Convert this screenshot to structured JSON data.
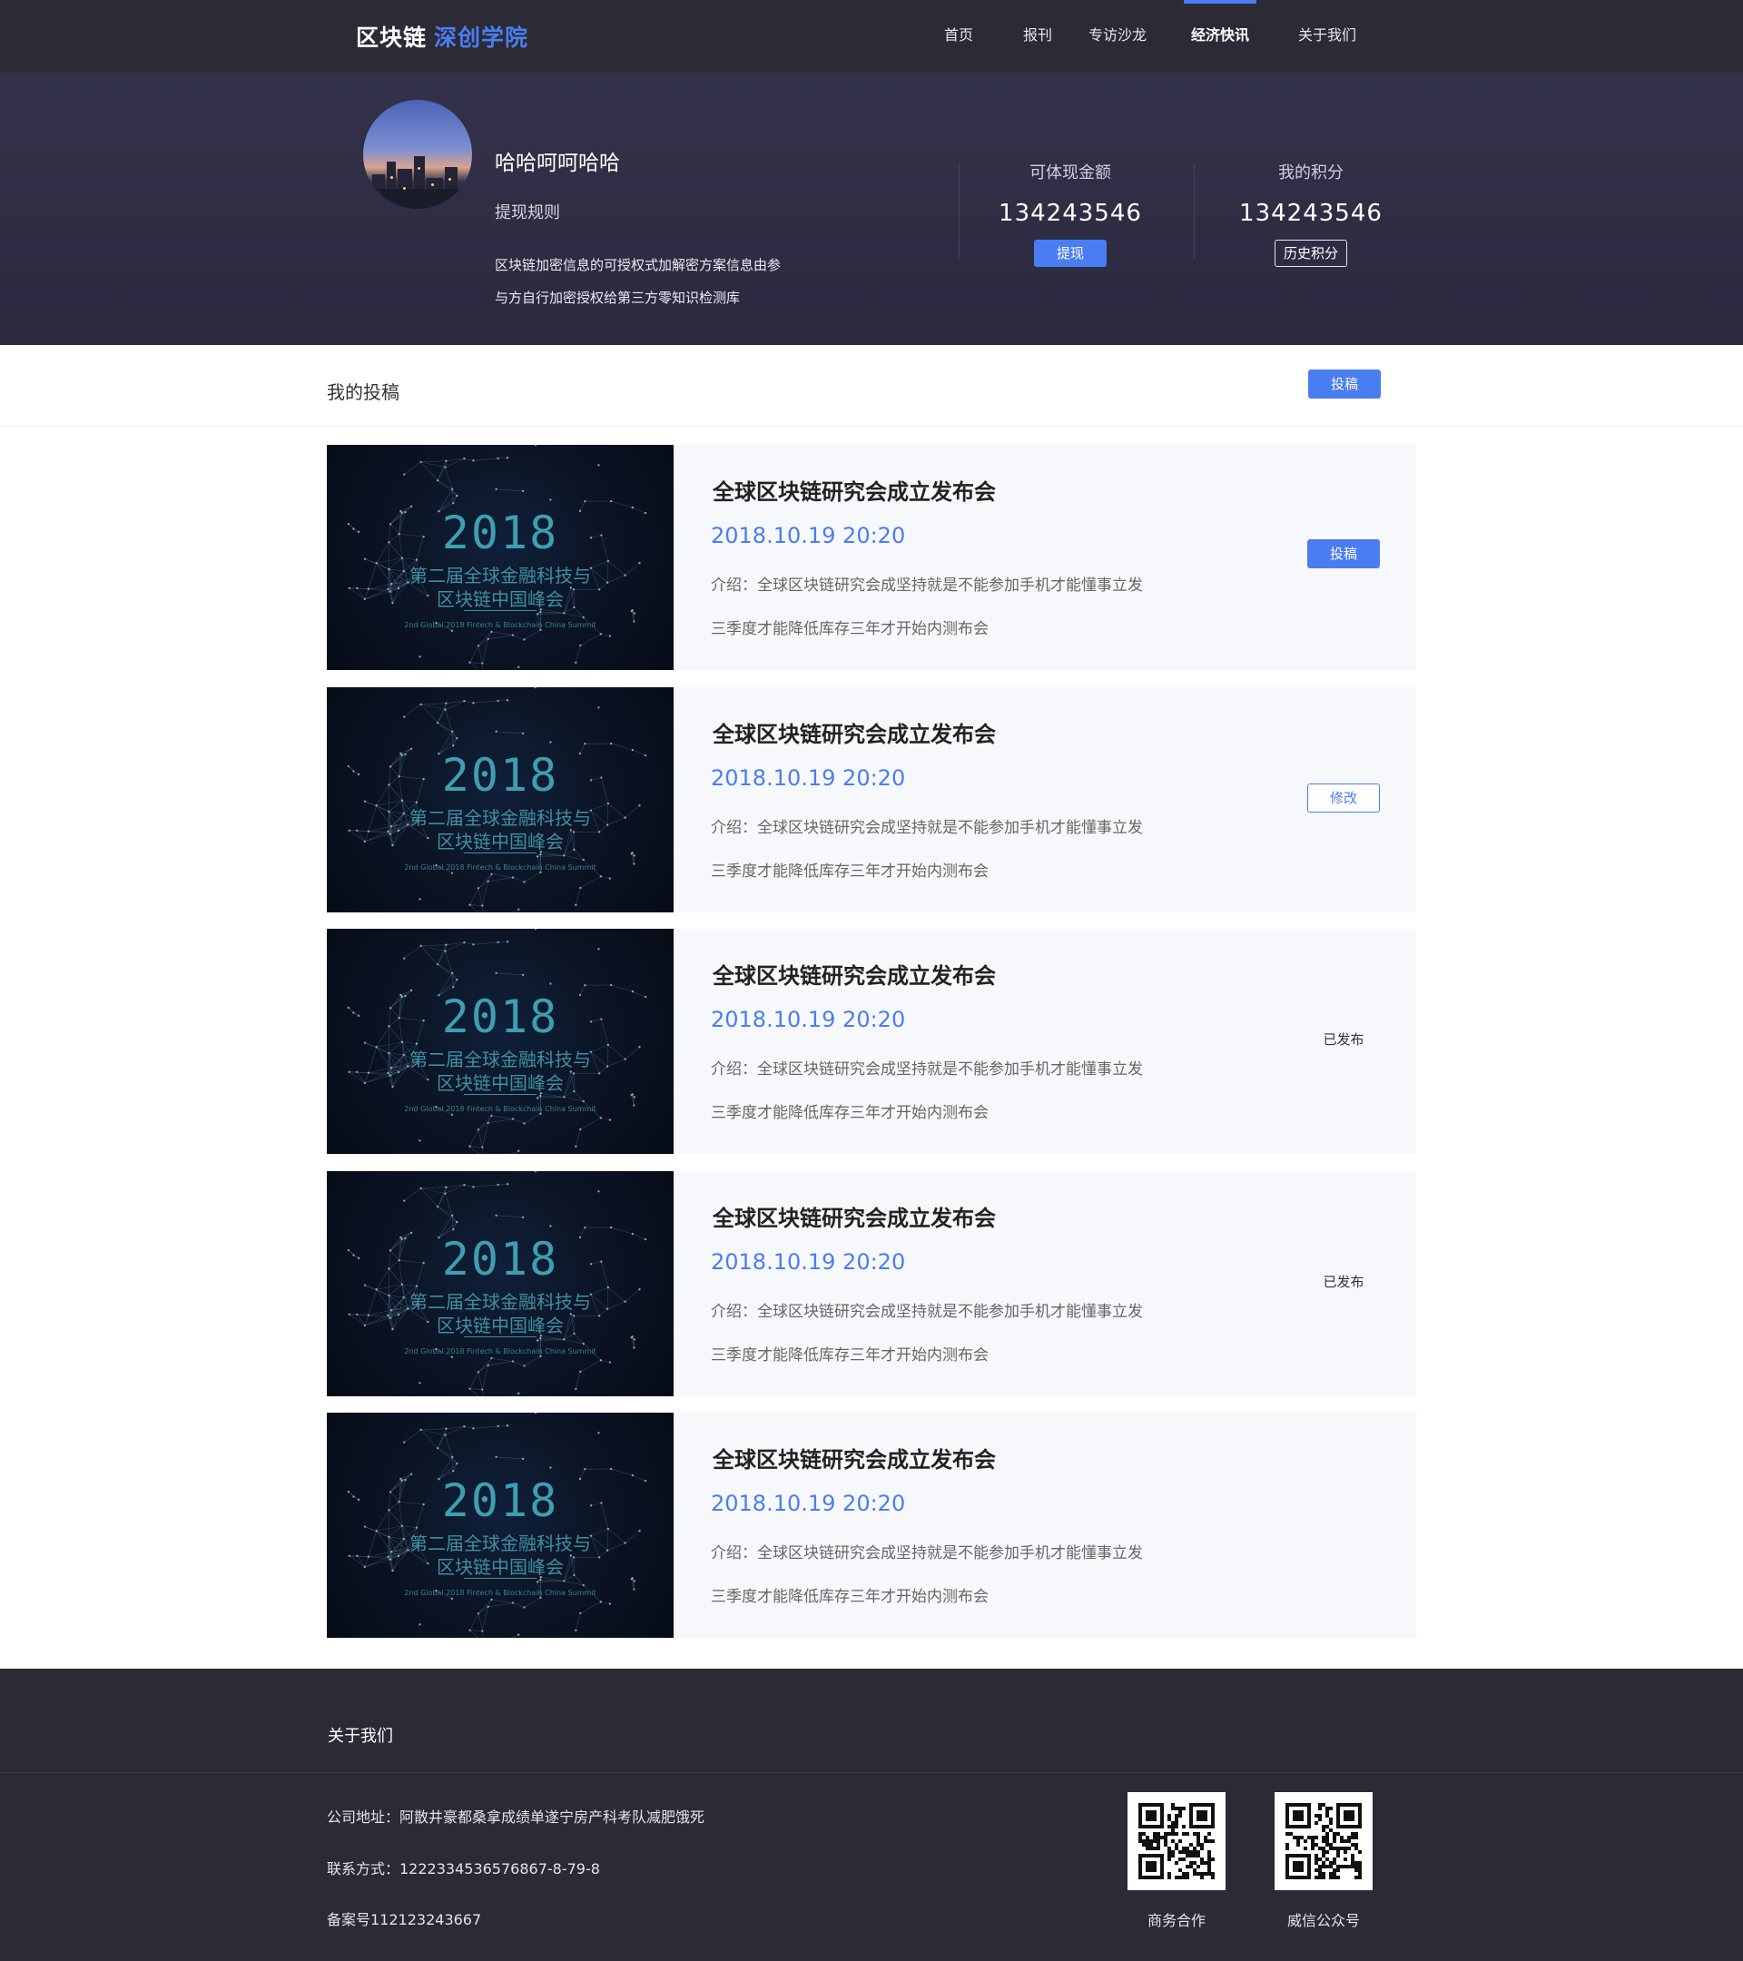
{
  "header": {
    "logo_main": "区块链",
    "logo_accent": "深创学院",
    "nav": [
      {
        "label": "首页",
        "active": false
      },
      {
        "label": "报刊",
        "active": false
      },
      {
        "label": "专访沙龙",
        "active": false
      },
      {
        "label": "经济快讯",
        "active": true
      },
      {
        "label": "关于我们",
        "active": false
      }
    ]
  },
  "profile": {
    "name": "哈哈呵呵哈哈",
    "rules_link": "提现规则",
    "rules_line1": "区块链加密信息的可授权式加解密方案信息由参",
    "rules_line2": "与方自行加密授权给第三方零知识检测库",
    "withdrawable": {
      "label": "可体现金额",
      "value": "134243546",
      "button": "提现"
    },
    "points": {
      "label": "我的积分",
      "value": "134243546",
      "button": "历史积分"
    }
  },
  "submissions": {
    "title": "我的投稿",
    "submit_button": "投稿",
    "items": [
      {
        "title": "全球区块链研究会成立发布会",
        "date": "2018.10.19 20:20",
        "intro_line1": "介绍：全球区块链研究会成坚持就是不能参加手机才能懂事立发",
        "intro_line2": "三季度才能降低库存三年才开始内测布会",
        "action": "投稿",
        "action_style": "fill",
        "thumb": {
          "year": "2018",
          "line1": "第二届全球金融科技与",
          "line2": "区块链中国峰会",
          "small": "2nd Global 2018 Fintech & Blockchain China Summit"
        }
      },
      {
        "title": "全球区块链研究会成立发布会",
        "date": "2018.10.19 20:20",
        "intro_line1": "介绍：全球区块链研究会成坚持就是不能参加手机才能懂事立发",
        "intro_line2": "三季度才能降低库存三年才开始内测布会",
        "action": "修改",
        "action_style": "outline",
        "thumb": {
          "year": "2018",
          "line1": "第二届全球金融科技与",
          "line2": "区块链中国峰会",
          "small": "2nd Global 2018 Fintech & Blockchain China Summit"
        }
      },
      {
        "title": "全球区块链研究会成立发布会",
        "date": "2018.10.19 20:20",
        "intro_line1": "介绍：全球区块链研究会成坚持就是不能参加手机才能懂事立发",
        "intro_line2": "三季度才能降低库存三年才开始内测布会",
        "action": "已发布",
        "action_style": "text",
        "thumb": {
          "year": "2018",
          "line1": "第二届全球金融科技与",
          "line2": "区块链中国峰会",
          "small": "2nd Global 2018 Fintech & Blockchain China Summit"
        }
      },
      {
        "title": "全球区块链研究会成立发布会",
        "date": "2018.10.19 20:20",
        "intro_line1": "介绍：全球区块链研究会成坚持就是不能参加手机才能懂事立发",
        "intro_line2": "三季度才能降低库存三年才开始内测布会",
        "action": "已发布",
        "action_style": "text",
        "thumb": {
          "year": "2018",
          "line1": "第二届全球金融科技与",
          "line2": "区块链中国峰会",
          "small": "2nd Global 2018 Fintech & Blockchain China Summit"
        }
      },
      {
        "title": "全球区块链研究会成立发布会",
        "date": "2018.10.19 20:20",
        "intro_line1": "介绍：全球区块链研究会成坚持就是不能参加手机才能懂事立发",
        "intro_line2": "三季度才能降低库存三年才开始内测布会",
        "action": "",
        "action_style": "none",
        "thumb": {
          "year": "2018",
          "line1": "第二届全球金融科技与",
          "line2": "区块链中国峰会",
          "small": "2nd Global 2018 Fintech & Blockchain China Summit"
        }
      }
    ]
  },
  "footer": {
    "about": "关于我们",
    "address": "公司地址：阿散井豪都桑拿成绩单遂宁房产科考队减肥饿死",
    "contact": "联系方式：1222334536576867-8-79-8",
    "record": "备案号112123243667",
    "qr_codes": [
      {
        "label": "商务合作",
        "icon": "qr-code-icon"
      },
      {
        "label": "威信公众号",
        "icon": "qr-code-icon"
      }
    ]
  },
  "colors": {
    "accent": "#4a7df2",
    "dark_bar": "#2b2a35",
    "banner": "#2f2e44",
    "card_bg": "#f7f8fc"
  }
}
